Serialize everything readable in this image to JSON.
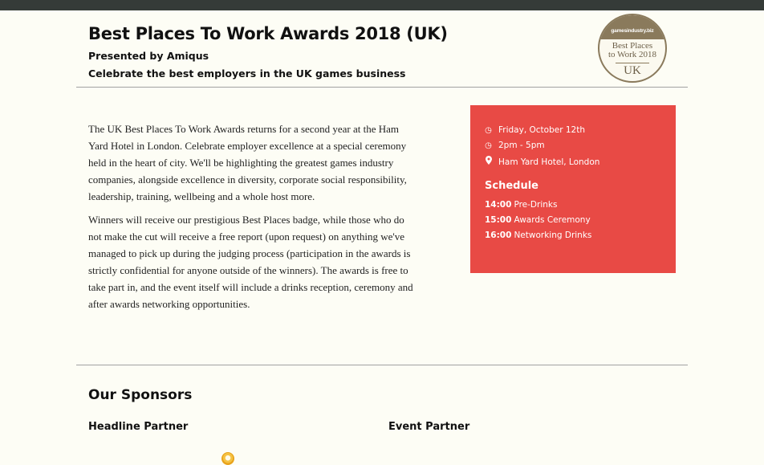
{
  "event": {
    "title": "Best Places To Work Awards 2018 (UK)",
    "presenter": "Presented by Amiqus",
    "tagline": "Celebrate the best employers in the UK games business"
  },
  "badge": {
    "brand": "gamesindustry.biz",
    "line1": "Best Places",
    "line2": "to Work 2018",
    "region": "UK"
  },
  "description": {
    "paragraphs": [
      "The UK Best Places To Work Awards returns for a second year at the Ham Yard Hotel in London. Celebrate employer excellence at a special ceremony held in the heart of city. We'll be highlighting the greatest games industry companies, alongside excellence in diversity, corporate social responsibility, leadership, training, wellbeing and a whole host more.",
      "Winners will receive our prestigious Best Places badge, while those who do not make the cut will receive a free report (upon request) on anything we've managed to pick up during the judging process (participation in the awards is strictly confidential for anyone outside of the winners). The awards is free to take part in, and the event itself will include a drinks reception, ceremony and after awards networking opportunities."
    ]
  },
  "details": {
    "date": "Friday, October 12th",
    "time": "2pm - 5pm",
    "venue": "Ham Yard Hotel, London",
    "schedule_title": "Schedule",
    "schedule": [
      {
        "time": "14:00",
        "item": "Pre-Drinks"
      },
      {
        "time": "15:00",
        "item": "Awards Ceremony"
      },
      {
        "time": "16:00",
        "item": "Networking Drinks"
      }
    ]
  },
  "sponsors": {
    "title": "Our Sponsors",
    "headline_label": "Headline Partner",
    "event_label": "Event Partner"
  },
  "icons": {
    "date": "clock-icon",
    "time": "clock-icon",
    "venue": "map-marker-icon"
  },
  "colors": {
    "accent": "#e84a45",
    "topbar": "#353b38",
    "background": "#fdfdf5",
    "badge": "#8a7a5c"
  }
}
